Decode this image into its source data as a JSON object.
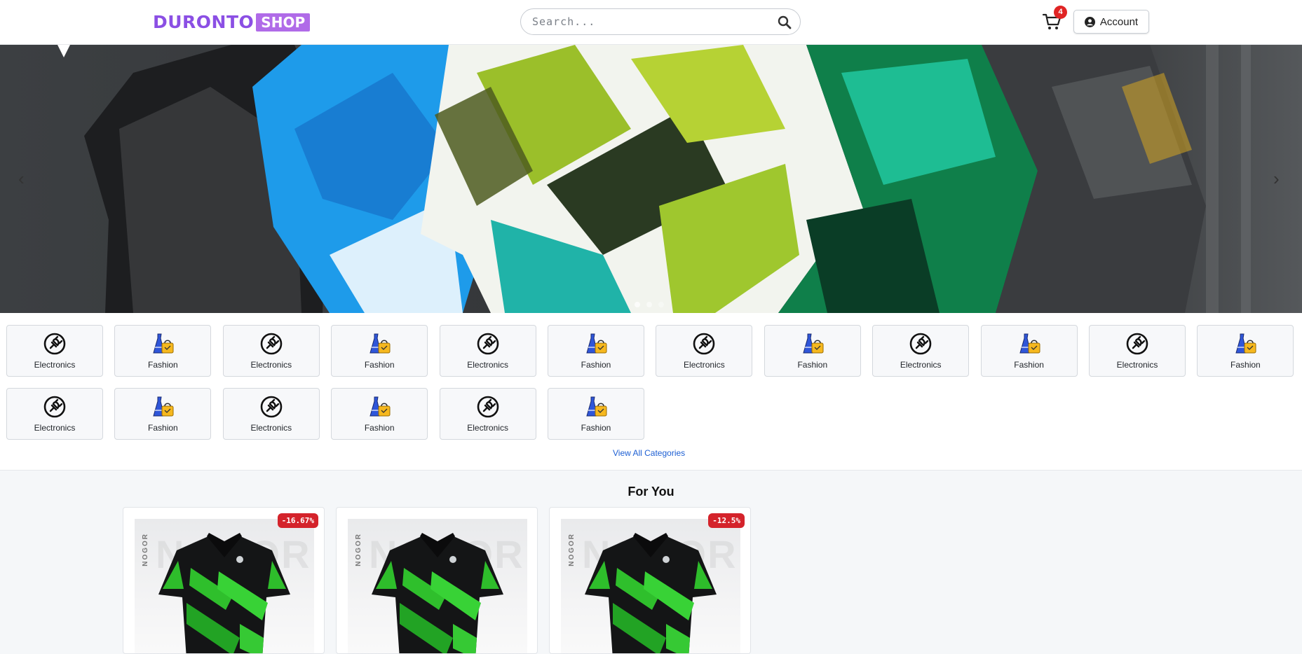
{
  "header": {
    "logo_main": "DURONTO",
    "logo_badge": "SHOP",
    "search_placeholder": "Search...",
    "search_value": "",
    "cart_count": "4",
    "account_label": "Account"
  },
  "hero": {
    "prev_label": "‹",
    "next_label": "›",
    "slide_count": 3,
    "active_slide": 1
  },
  "categories": {
    "items": [
      {
        "label": "Electronics",
        "icon": "plug-icon"
      },
      {
        "label": "Fashion",
        "icon": "dress-bag-icon"
      },
      {
        "label": "Electronics",
        "icon": "plug-icon"
      },
      {
        "label": "Fashion",
        "icon": "dress-bag-icon"
      },
      {
        "label": "Electronics",
        "icon": "plug-icon"
      },
      {
        "label": "Fashion",
        "icon": "dress-bag-icon"
      },
      {
        "label": "Electronics",
        "icon": "plug-icon"
      },
      {
        "label": "Fashion",
        "icon": "dress-bag-icon"
      },
      {
        "label": "Electronics",
        "icon": "plug-icon"
      },
      {
        "label": "Fashion",
        "icon": "dress-bag-icon"
      },
      {
        "label": "Electronics",
        "icon": "plug-icon"
      },
      {
        "label": "Fashion",
        "icon": "dress-bag-icon"
      },
      {
        "label": "Electronics",
        "icon": "plug-icon"
      },
      {
        "label": "Fashion",
        "icon": "dress-bag-icon"
      },
      {
        "label": "Electronics",
        "icon": "plug-icon"
      },
      {
        "label": "Fashion",
        "icon": "dress-bag-icon"
      },
      {
        "label": "Electronics",
        "icon": "plug-icon"
      },
      {
        "label": "Fashion",
        "icon": "dress-bag-icon"
      }
    ],
    "view_all": "View All Categories"
  },
  "for_you": {
    "title": "For You",
    "products": [
      {
        "discount": "-16.67%",
        "brand": "NOGOR"
      },
      {
        "discount": "",
        "brand": "NOGOR"
      },
      {
        "discount": "-12.5%",
        "brand": "NOGOR"
      }
    ]
  },
  "colors": {
    "brand_purple": "#8b4fe4",
    "badge_red": "#e02424",
    "link_blue": "#1d5fd3"
  }
}
